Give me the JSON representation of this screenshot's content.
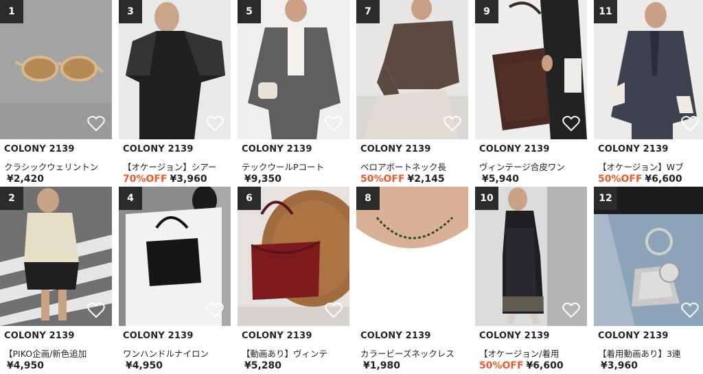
{
  "products": [
    {
      "rank": "1",
      "brand": "COLONY 2139",
      "name": "クラシックウェリントン",
      "discount": "",
      "price": "¥2,420",
      "photo": "sunglasses",
      "favorite_icon": "heart-outline-icon"
    },
    {
      "rank": "3",
      "brand": "COLONY 2139",
      "name": "【オケージョン】シアー",
      "discount": "70%OFF",
      "price": "¥3,960",
      "photo": "sheer-dress",
      "favorite_icon": "heart-outline-icon"
    },
    {
      "rank": "5",
      "brand": "COLONY 2139",
      "name": "テックウールPコート",
      "discount": "",
      "price": "¥9,350",
      "photo": "grey-coat",
      "favorite_icon": "heart-outline-icon"
    },
    {
      "rank": "7",
      "brand": "COLONY 2139",
      "name": "ベロアボートネック長",
      "discount": "50%OFF",
      "price": "¥2,145",
      "photo": "velour-top",
      "favorite_icon": "heart-outline-icon"
    },
    {
      "rank": "9",
      "brand": "COLONY 2139",
      "name": "ヴィンテージ合皮ワン",
      "discount": "",
      "price": "¥5,940",
      "photo": "leather-bag",
      "favorite_icon": "heart-outline-icon"
    },
    {
      "rank": "11",
      "brand": "COLONY 2139",
      "name": "【オケージョン】Wブ",
      "discount": "50%OFF",
      "price": "¥6,600",
      "photo": "navy-blazer",
      "favorite_icon": "heart-outline-icon"
    },
    {
      "rank": "2",
      "brand": "COLONY 2139",
      "name": "【PIKO企画/新色追加",
      "discount": "",
      "price": "¥4,950",
      "photo": "knit-polo",
      "favorite_icon": "heart-outline-icon"
    },
    {
      "rank": "4",
      "brand": "COLONY 2139",
      "name": "ワンハンドルナイロン",
      "discount": "",
      "price": "¥4,950",
      "photo": "nylon-bag",
      "favorite_icon": "heart-outline-icon"
    },
    {
      "rank": "6",
      "brand": "COLONY 2139",
      "name": "【動画あり】ヴィンテ",
      "discount": "",
      "price": "¥5,280",
      "photo": "red-bag",
      "favorite_icon": "heart-outline-icon"
    },
    {
      "rank": "8",
      "brand": "COLONY 2139",
      "name": "カラービーズネックレス",
      "discount": "",
      "price": "¥1,980",
      "photo": "bead-necklace",
      "favorite_icon": "heart-outline-icon"
    },
    {
      "rank": "10",
      "brand": "COLONY 2139",
      "name": "【オケージョン/着用",
      "discount": "50%OFF",
      "price": "¥6,600",
      "photo": "lace-dress",
      "favorite_icon": "heart-outline-icon"
    },
    {
      "rank": "12",
      "brand": "COLONY 2139",
      "name": "【着用動画あり】3連",
      "discount": "",
      "price": "¥3,960",
      "photo": "silver-bag",
      "favorite_icon": "heart-outline-icon"
    }
  ],
  "colors": {
    "rank_badge_bg": "#2b2b2b",
    "discount": "#f05a28",
    "text": "#222222"
  }
}
